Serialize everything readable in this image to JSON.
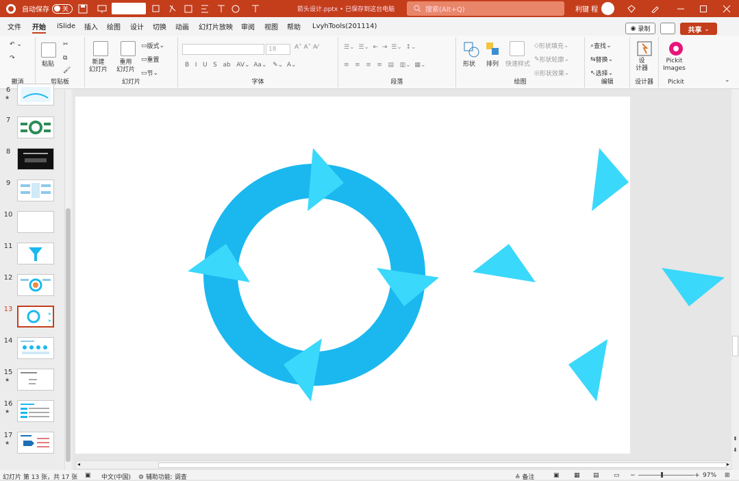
{
  "titlebar": {
    "autosave_label": "自动保存",
    "autosave_state": "关",
    "doc_title": "箭头设计.pptx • 已保存到这台电脑",
    "search_placeholder": "搜索(Alt+Q)",
    "user_name": "利键 程"
  },
  "menu": {
    "tabs": [
      "文件",
      "开始",
      "iSlide",
      "插入",
      "绘图",
      "设计",
      "切换",
      "动画",
      "幻灯片放映",
      "审阅",
      "视图",
      "帮助",
      "LvyhTools(201114)"
    ],
    "active": "开始",
    "record": "录制",
    "share": "共享"
  },
  "ribbon": {
    "groups": {
      "undo": "撤消",
      "clipboard": "剪贴板",
      "slides": "幻灯片",
      "font": "字体",
      "paragraph": "段落",
      "drawing": "绘图",
      "edit": "编辑",
      "designer": "设计器",
      "pickit": "Pickit"
    },
    "paste": "粘贴",
    "new_slide": "新建\n幻灯片",
    "reuse_slide": "重用\n幻灯片",
    "layout": "版式",
    "reset": "重置",
    "section": "节",
    "font_size": "18",
    "shape": "形状",
    "arrange": "排列",
    "quick_style": "快速样式",
    "shape_fill": "形状填充",
    "shape_outline": "形状轮廓",
    "shape_effect": "形状效果",
    "find": "查找",
    "replace": "替换",
    "select": "选择",
    "designer_btn": "设\n计器",
    "pickit_btn": "Pickit\nImages"
  },
  "thumbnails": [
    {
      "num": "6",
      "star": true
    },
    {
      "num": "7",
      "star": false
    },
    {
      "num": "8",
      "star": false
    },
    {
      "num": "9",
      "star": false
    },
    {
      "num": "10",
      "star": false
    },
    {
      "num": "11",
      "star": false
    },
    {
      "num": "12",
      "star": false
    },
    {
      "num": "13",
      "star": false,
      "selected": true
    },
    {
      "num": "14",
      "star": false
    },
    {
      "num": "15",
      "star": true
    },
    {
      "num": "16",
      "star": true
    },
    {
      "num": "17",
      "star": true
    }
  ],
  "status": {
    "slide_info": "幻灯片 第 13 张，共 17 张",
    "language": "中文(中国)",
    "accessibility": "辅助功能: 调查",
    "notes": "备注",
    "zoom": "97%"
  },
  "colors": {
    "ring": "#1bb8ef",
    "triangle": "#3ad8fb",
    "accent": "#c43e1c"
  }
}
